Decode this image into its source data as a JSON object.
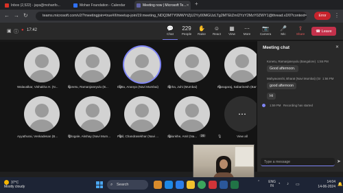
{
  "browser": {
    "tabs": [
      {
        "label": "Inbox (2,522) - jaya@mohanfo...",
        "color": "#d93025"
      },
      {
        "label": "Mohan Foundation - Calendar",
        "color": "#2f72ff"
      },
      {
        "label": "Meeting now | Microsoft Te...",
        "color": "#6264a7"
      }
    ],
    "new_tab": "+",
    "url": "teams.microsoft.com/v2/?meetingjoin=true#/l/meetup-join/19:meeting_NDQ3MTY0MWYtZjU2Yy00MGUzLTg2MTEtZmI2YzY2MzY0ZWY1@thread.v2/0?context=...",
    "error_button": "Error",
    "nav": {
      "back": "←",
      "forward": "→",
      "reload": "↻"
    }
  },
  "toolbar": {
    "timer": "17:42",
    "items": [
      {
        "label": "Chat",
        "glyph": "💬"
      },
      {
        "label": "People",
        "glyph": "👥",
        "count": "229"
      },
      {
        "label": "Raise",
        "glyph": "✋"
      },
      {
        "label": "React",
        "glyph": "☺"
      },
      {
        "label": "View",
        "glyph": "▦"
      },
      {
        "label": "More",
        "glyph": "⋯"
      },
      {
        "label": "Camera",
        "glyph": "📷"
      },
      {
        "label": "Mic",
        "glyph": "🎤"
      },
      {
        "label": "Share",
        "glyph": "⇪"
      }
    ],
    "leave_label": "Leave"
  },
  "participants": [
    {
      "name": "Walavalkar, Vishakha H. (N...",
      "speaking": false
    },
    {
      "name": "Konetu, Ramanjaneyulu (B...",
      "speaking": false
    },
    {
      "name": "Dutta, Ananya (Navi Mumbai)",
      "speaking": true
    },
    {
      "name": "Sinha, Juhi (Mumbai)",
      "speaking": false
    },
    {
      "name": "Kanagaraj, Sabarinesh (Ban...",
      "speaking": false
    },
    {
      "name": "Ayyathurai, Venkadesan (B...",
      "speaking": false
    },
    {
      "name": "Ghogale, Akshay (Navi Mum...",
      "speaking": false
    },
    {
      "name": "Patil, Chandrasekhar (Navi ...",
      "speaking": false
    },
    {
      "name": "Salunkhe, Amit (Na...",
      "speaking": false,
      "badge": "26"
    }
  ],
  "view_all_label": "View all",
  "view_all_glyph": "⋯",
  "chat": {
    "title": "Meeting chat",
    "messages": [
      {
        "sender": "Konetu, Ramanjaneyulu (Bangalore)",
        "time": "1:55 PM",
        "text": "Good afternoon."
      },
      {
        "sender": "Mahyavanshi, Bharat (Navi Mumbai) (Gr",
        "time": "1:56 PM",
        "text": "good afternoon"
      },
      {
        "sender": "",
        "time": "",
        "text": "Hi"
      }
    ],
    "system": {
      "time": "1:59 PM",
      "text": "Recording has started"
    },
    "composer_placeholder": "Type a message",
    "send_glyph": "➤"
  },
  "taskbar": {
    "temperature": "37°C",
    "weather": "Mostly cloudy",
    "search_placeholder": "Search",
    "language": "ENG",
    "region": "IN",
    "time": "14:04",
    "date": "14-06-2024"
  },
  "colors": {
    "accent": "#7f85f5",
    "leave": "#c4314b",
    "error": "#c8232c"
  }
}
